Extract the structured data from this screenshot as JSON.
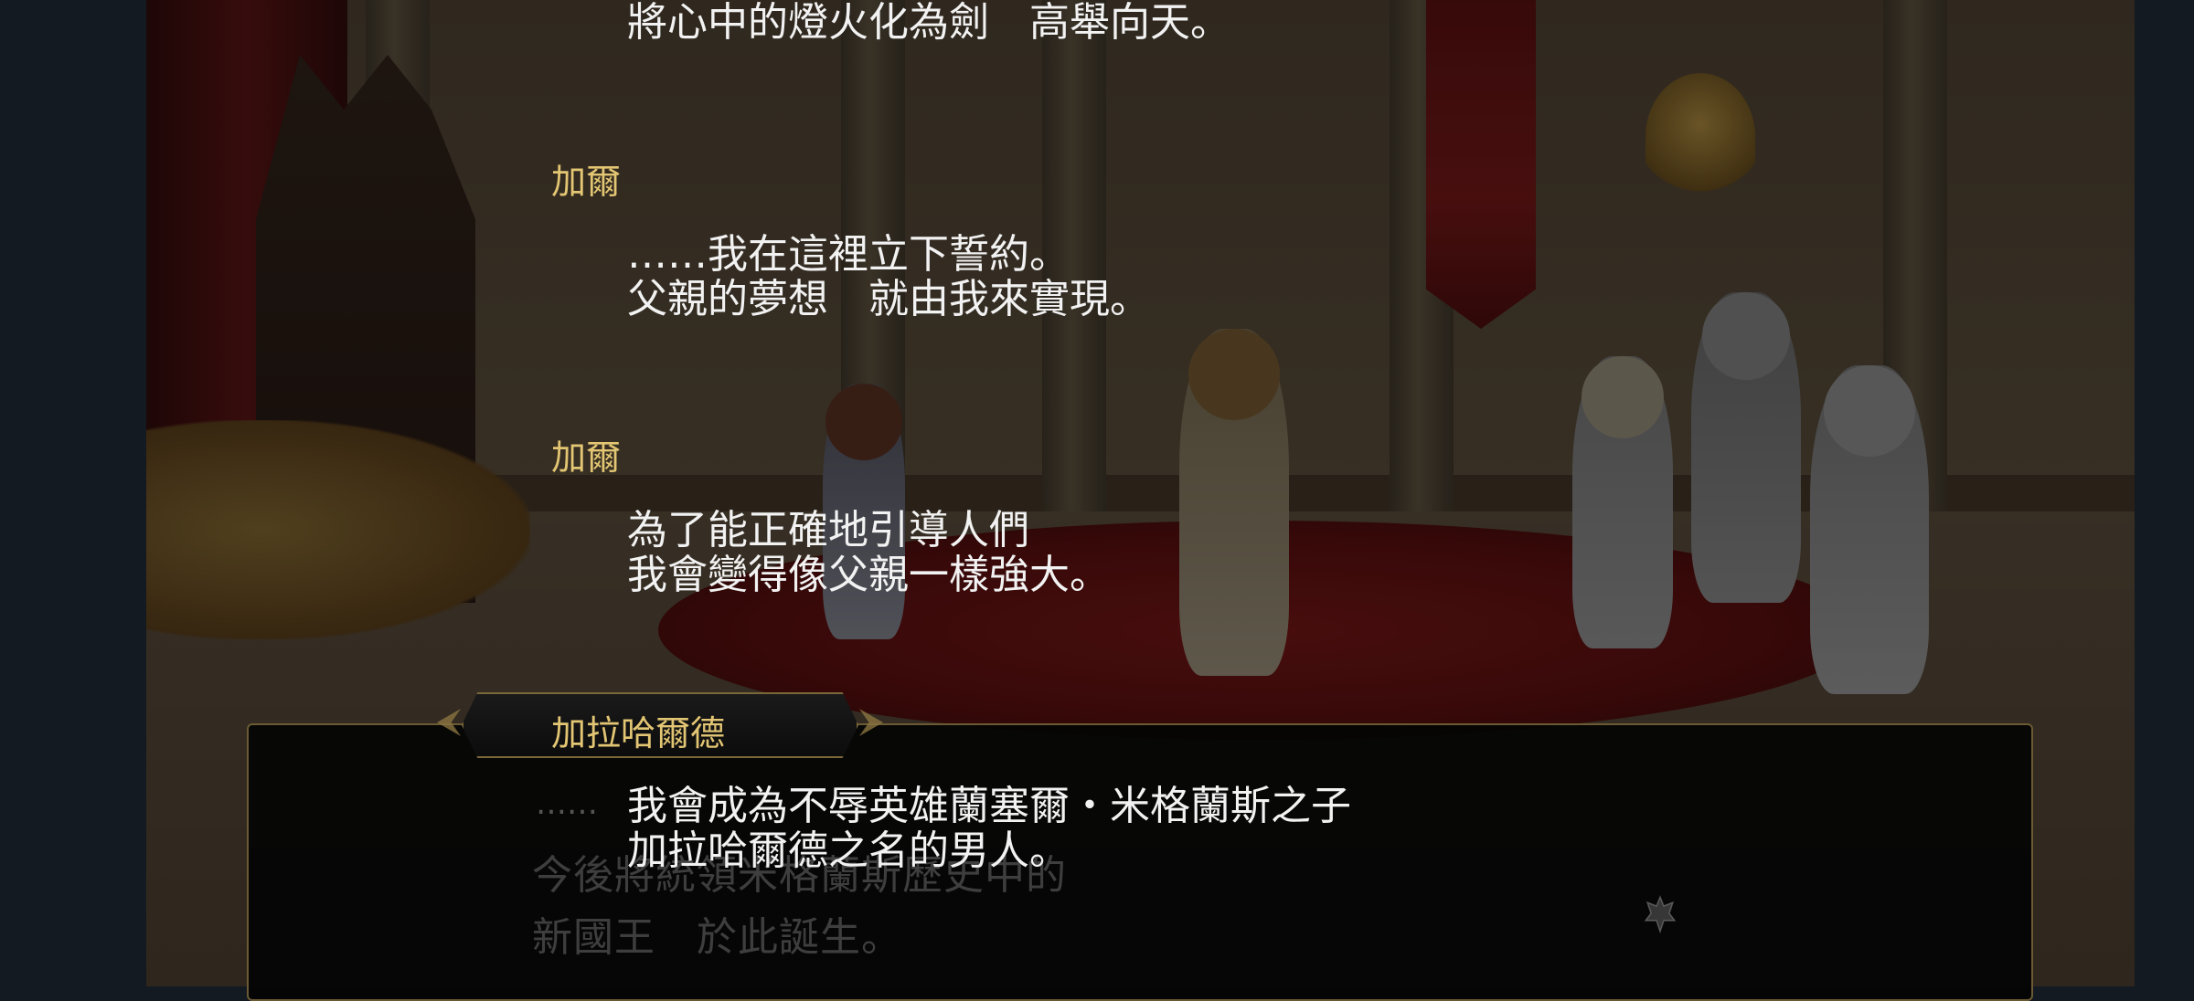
{
  "backlog": {
    "top_line": "將心中的燈火化為劍　高舉向天。",
    "entries": [
      {
        "speaker": "加爾",
        "line1": "……我在這裡立下誓約。",
        "line2": "父親的夢想　就由我來實現。"
      },
      {
        "speaker": "加爾",
        "line1": "為了能正確地引導人們",
        "line2": "我會變得像父親一樣強大。"
      },
      {
        "speaker": "加拉哈爾德",
        "line1": "我會成為不辱英雄蘭塞爾・米格蘭斯之子",
        "line2": "加拉哈爾德之名的男人。"
      }
    ]
  },
  "dialog": {
    "faint_ellipsis": "……",
    "ghost_line1": "今後將統領米格蘭斯歷史中的",
    "ghost_line2": "新國王　於此誕生。",
    "advance_icon": "crest-advance-icon"
  },
  "colors": {
    "speaker": "#e3c673",
    "text": "#f2f2f2",
    "frame_gold": "#7a6838",
    "outer_bg": "#131a21"
  }
}
